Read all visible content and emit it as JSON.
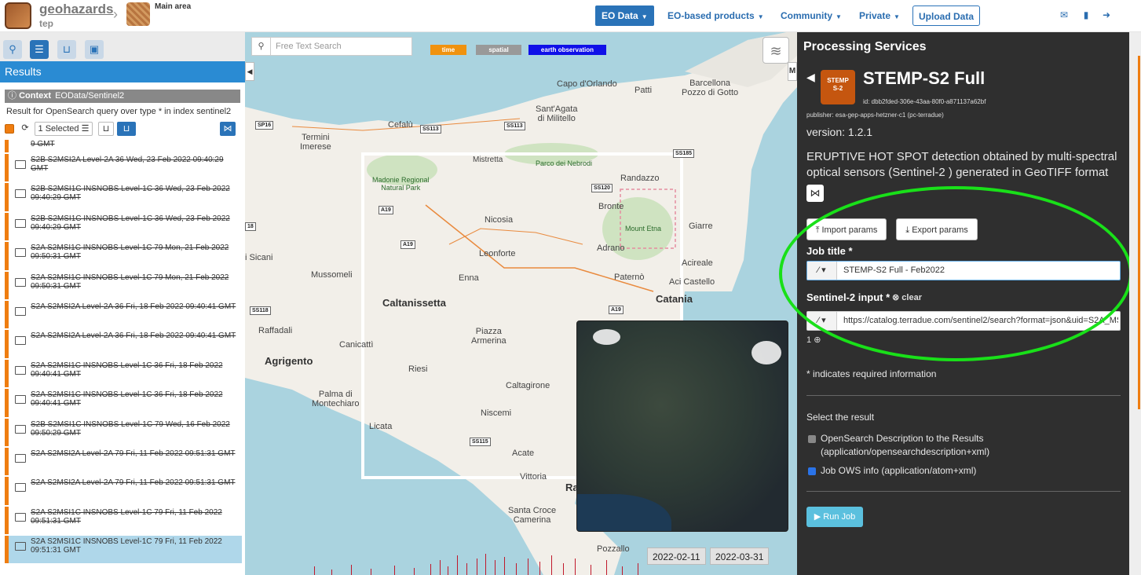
{
  "topbar": {
    "logo_title": "geohazards",
    "logo_sub": "tep",
    "breadcrumb": "Main area",
    "nav": {
      "eo_data": "EO Data",
      "eo_products": "EO-based products",
      "community": "Community",
      "private": "Private",
      "upload": "Upload Data"
    },
    "icons": [
      "envelope-icon",
      "book-icon",
      "sign-out-icon"
    ]
  },
  "left": {
    "results_title": "Results",
    "context_label": "Context",
    "context_value": "EOData/Sentinel2",
    "query_text": "Result for OpenSearch query over type * in index sentinel2",
    "selected_label": "1 Selected",
    "items": [
      "9 GMT",
      "S2B S2MSI2A Level-2A 36 Wed, 23 Feb 2022 09:40:29 GMT",
      "S2B S2MSI1C INSNOBS Level-1C 36 Wed, 23 Feb 2022 09:40:29 GMT",
      "S2B S2MSI1C INSNOBS Level-1C 36 Wed, 23 Feb 2022 09:40:29 GMT",
      "S2A S2MSI1C INSNOBS Level-1C 79 Mon, 21 Feb 2022 09:50:31 GMT",
      "S2A S2MSI1C INSNOBS Level-1C 79 Mon, 21 Feb 2022 09:50:31 GMT",
      "S2A S2MSI2A Level-2A 36 Fri, 18 Feb 2022 09:40:41 GMT",
      "S2A S2MSI2A Level-2A 36 Fri, 18 Feb 2022 09:40:41 GMT",
      "S2A S2MSI1C INSNOBS Level-1C 36 Fri, 18 Feb 2022 09:40:41 GMT",
      "S2A S2MSI1C INSNOBS Level-1C 36 Fri, 18 Feb 2022 09:40:41 GMT",
      "S2B S2MSI1C INSNOBS Level-1C 79 Wed, 16 Feb 2022 09:50:29 GMT",
      "S2A S2MSI2A Level-2A 79 Fri, 11 Feb 2022 09:51:31 GMT",
      "S2A S2MSI2A Level-2A 79 Fri, 11 Feb 2022 09:51:31 GMT",
      "S2A S2MSI1C INSNOBS Level-1C 79 Fri, 11 Feb 2022 09:51:31 GMT",
      "S2A S2MSI1C INSNOBS Level-1C 79 Fri, 11 Feb 2022 09:51:31 GMT"
    ]
  },
  "map": {
    "search_placeholder": "Free Text Search",
    "chips": {
      "time": "time",
      "spatial": "spatial",
      "eo": "earth observation"
    },
    "chip_colors": {
      "time": "#f0920f",
      "spatial": "#999999",
      "eo": "#1010e8"
    },
    "labels": {
      "capo": "Capo d'Orlando",
      "patti": "Patti",
      "barcellona": "Barcellona\nPozzo di Gotto",
      "santagata": "Sant'Agata\ndi Militello",
      "cefalu": "Cefalù",
      "termini": "Termini\nImerese",
      "mistretta": "Mistretta",
      "nebrodi": "Parco dei Nebrodi",
      "randazzo": "Randazzo",
      "madonie": "Madonie Regional\nNatural Park",
      "bronte": "Bronte",
      "etna": "Mount Etna",
      "giarre": "Giarre",
      "nicosia": "Nicosia",
      "leonforte": "Leonforte",
      "adrano": "Adrano",
      "acireale": "Acireale",
      "sicani": "i Sicani",
      "mussomeli": "Mussomeli",
      "enna": "Enna",
      "paterno": "Paternò",
      "acicastello": "Aci Castello",
      "caltanissetta": "Caltanissetta",
      "catania": "Catania",
      "raffadali": "Raffadali",
      "canicatti": "Canicattì",
      "piazza": "Piazza\nArmerina",
      "agrigento": "Agrigento",
      "riesi": "Riesi",
      "palma": "Palma di\nMontechiaro",
      "caltagirone": "Caltagirone",
      "niscemi": "Niscemi",
      "licata": "Licata",
      "acate": "Acate",
      "vittoria": "Vittoria",
      "ra": "Ra",
      "santacroce": "Santa Croce\nCamerina",
      "pozzallo": "Pozzallo"
    },
    "roads": {
      "sp16": "SP16",
      "ss113a": "SS113",
      "ss113b": "SS113",
      "ss185": "SS185",
      "ss120": "SS120",
      "a19a": "A19",
      "a19b": "A19",
      "a19c": "A19",
      "n18": "18",
      "ss118": "SS118",
      "ss115": "SS115"
    },
    "dates": {
      "start": "2022-02-11",
      "end": "2022-03-31"
    }
  },
  "right": {
    "panel_title": "Processing Services",
    "service": {
      "logo_text": "STEMP\nS-2",
      "name": "STEMP-S2 Full",
      "id": "id: dbb2fded-306e-43aa-80f0-a871137a62bf",
      "publisher": "publisher: esa-gep-apps-hetzner-c1 (pc-terradue)",
      "version": "version: 1.2.1",
      "description": "ERUPTIVE HOT SPOT detection obtained by multi-spectral optical sensors (Sentinel-2 ) generated in GeoTIFF format"
    },
    "import_params": "Import params",
    "export_params": "Export params",
    "job_title_label": "Job title *",
    "job_title_value": "STEMP-S2 Full - Feb2022",
    "input_label": "Sentinel-2 input *",
    "clear_label": "clear",
    "input_value": "https://catalog.terradue.com/sentinel2/search?format=json&uid=S2A_MSIL1C_20220211T095131_N0400_R079_T33SVB",
    "count": "1",
    "required_note": "* indicates required information",
    "select_result": "Select the result",
    "opt1": "OpenSearch Description to the Results (application/opensearchdescription+xml)",
    "opt2": "Job OWS info (application/atom+xml)",
    "run_job": "Run Job"
  }
}
